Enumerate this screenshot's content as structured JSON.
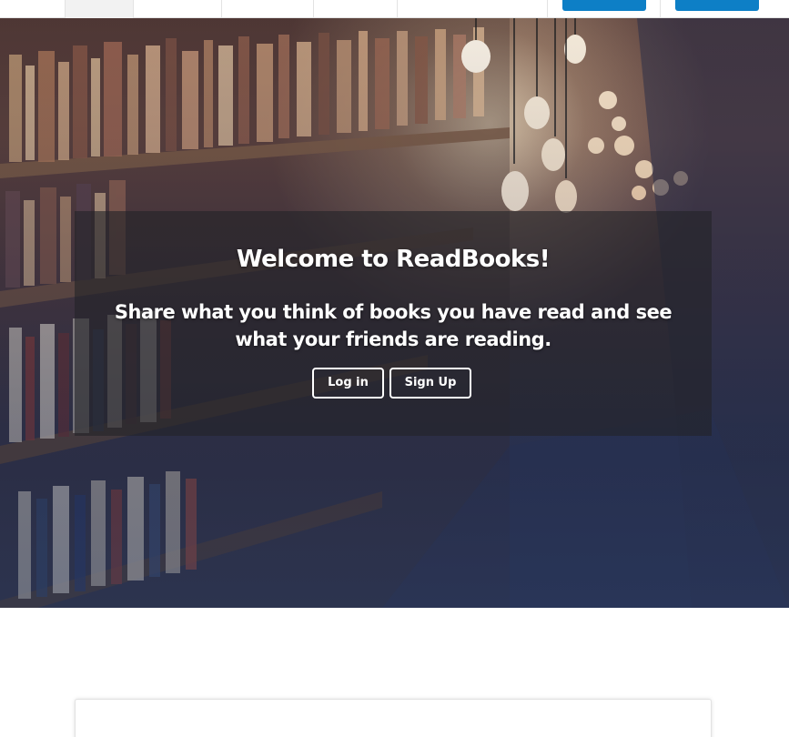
{
  "hero": {
    "title": "Welcome to ReadBooks!",
    "subtitle": "Share what you think of books you have read and see what your friends are reading.",
    "login_label": "Log in",
    "signup_label": "Sign Up"
  },
  "colors": {
    "nav_button": "#0d7fc6",
    "overlay": "rgba(35,35,40,0.62)",
    "white": "#ffffff"
  }
}
